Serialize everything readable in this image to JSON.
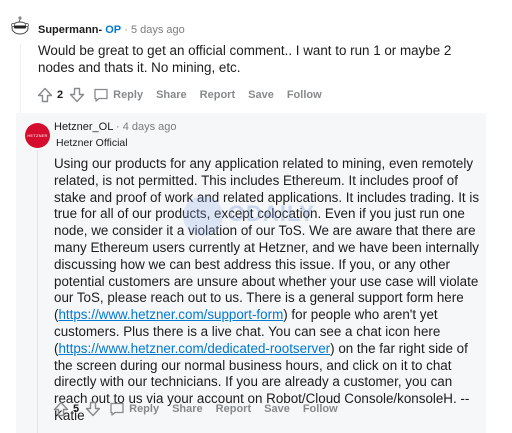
{
  "comment1": {
    "author": "Supermann-",
    "op_badge": "OP",
    "separator": " · ",
    "time": "5 days ago",
    "body": "Would be great to get an official comment.. I want to run 1 or maybe 2 nodes and thats it. No mining, etc.",
    "score": "2",
    "actions": [
      "Reply",
      "Share",
      "Report",
      "Save",
      "Follow"
    ]
  },
  "comment2": {
    "author": "Hetzner_OL",
    "separator": " · ",
    "time": "4 days ago",
    "flair": "Hetzner Official",
    "avatar_text": "HETZNER",
    "body_parts": [
      "Using our products for any application related to mining, even remotely related, is not permitted. This includes Ethereum. It includes proof of stake and proof of work and related applications. It includes trading. It is true for all of our products, except colocation. Even if you just run one node, we consider it a violation of our ToS. We are aware that there are many Ethereum users currently at Hetzner, and we have been internally discussing how we can best address this issue. If you, or any other potential customers are unsure about whether your use case will violate our ToS, please reach out to us. There is a general support form here (",
      "https://www.hetzner.com/support-form",
      ") for people who aren't yet customers. Plus there is a live chat. You can see a chat icon here (",
      "https://www.hetzner.com/dedicated-rootserver",
      ") on the far right side of the screen during our normal business hours, and click on it to chat directly with our technicians. If you are already a customer, you can reach out to us via your account on Robot/Cloud Console/konsoleH. --Katie"
    ],
    "score": "5",
    "actions": [
      "Reply",
      "Share",
      "Report",
      "Save",
      "Follow"
    ]
  },
  "watermark": "ODAILY",
  "colors": {
    "link": "#0079d3",
    "op": "#0079d3",
    "hetzner_red": "#d50c2d"
  }
}
